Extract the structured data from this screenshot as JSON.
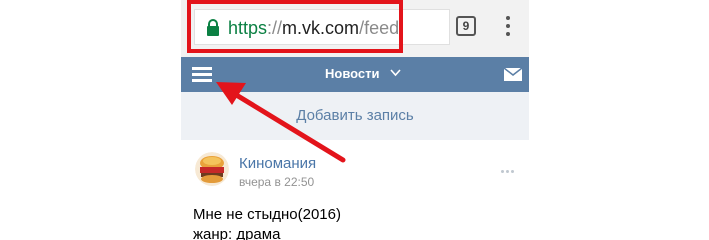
{
  "browser": {
    "url_scheme": "https",
    "url_separator": "://",
    "url_host": "m.vk.com",
    "url_path": "/feed",
    "tab_count": "9"
  },
  "vk_header": {
    "title": "Новости"
  },
  "add_post": {
    "label": "Добавить запись"
  },
  "post": {
    "author": "Киномания",
    "time": "вчера в 22:50",
    "lines": [
      "Мне не стыдно(2016)",
      "жанр: драма"
    ]
  },
  "annotation": {
    "highlight_color": "#e3141b"
  },
  "colors": {
    "vk_blue": "#5b7fa6",
    "secure_green": "#0b8043"
  }
}
